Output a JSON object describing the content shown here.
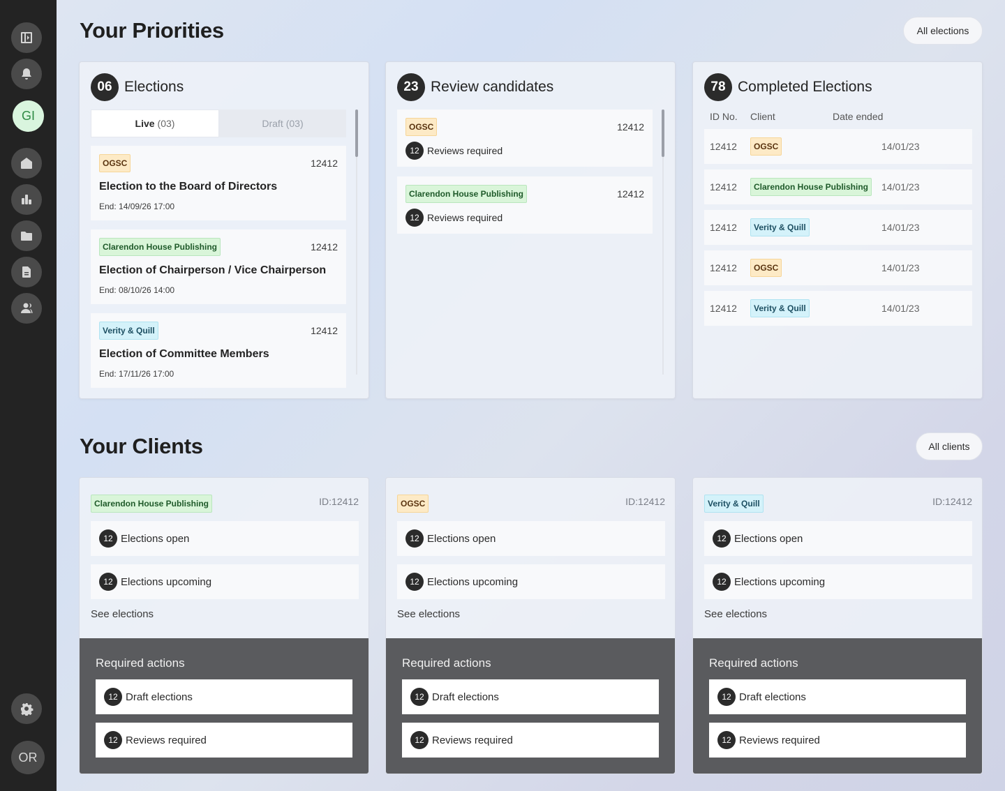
{
  "sidebar": {
    "user_initials": "GI",
    "profile_initials": "OR"
  },
  "priorities": {
    "title": "Your Priorities",
    "all_button": "All elections",
    "elections": {
      "count": "06",
      "title": "Elections",
      "tabs": [
        {
          "label": "Live",
          "count": "(03)"
        },
        {
          "label": "Draft",
          "count": "(03)"
        }
      ],
      "items": [
        {
          "tag": "OGSC",
          "id": "12412",
          "title": "Election to the Board of Directors",
          "end": "End: 14/09/26 17:00"
        },
        {
          "tag": "Clarendon House Publishing",
          "id": "12412",
          "title": "Election of Chairperson / Vice Chairperson",
          "end": "End: 08/10/26 14:00"
        },
        {
          "tag": "Verity & Quill",
          "id": "12412",
          "title": "Election of Committee Members",
          "end": "End: 17/11/26 17:00"
        }
      ]
    },
    "review": {
      "count": "23",
      "title": "Review candidates",
      "items": [
        {
          "tag": "OGSC",
          "id": "12412",
          "num": "12",
          "label": "Reviews required"
        },
        {
          "tag": "Clarendon House Publishing",
          "id": "12412",
          "num": "12",
          "label": "Reviews required"
        }
      ]
    },
    "completed": {
      "count": "78",
      "title": "Completed Elections",
      "headers": {
        "id": "ID No.",
        "client": "Client",
        "date": "Date ended"
      },
      "rows": [
        {
          "id": "12412",
          "client": "OGSC",
          "date": "14/01/23"
        },
        {
          "id": "12412",
          "client": "Clarendon House Publishing",
          "date": "14/01/23"
        },
        {
          "id": "12412",
          "client": "Verity & Quill",
          "date": "14/01/23"
        },
        {
          "id": "12412",
          "client": "OGSC",
          "date": "14/01/23"
        },
        {
          "id": "12412",
          "client": "Verity & Quill",
          "date": "14/01/23"
        }
      ]
    }
  },
  "clients": {
    "title": "Your Clients",
    "all_button": "All clients",
    "cards": [
      {
        "tag": "Clarendon House Publishing",
        "id_label": "ID:12412",
        "rows": [
          {
            "num": "12",
            "label": "Elections open"
          },
          {
            "num": "12",
            "label": "Elections upcoming"
          }
        ],
        "see": "See elections",
        "required_title": "Required actions",
        "required": [
          {
            "num": "12",
            "label": "Draft elections"
          },
          {
            "num": "12",
            "label": "Reviews required"
          }
        ]
      },
      {
        "tag": "OGSC",
        "id_label": "ID:12412",
        "rows": [
          {
            "num": "12",
            "label": "Elections open"
          },
          {
            "num": "12",
            "label": "Elections upcoming"
          }
        ],
        "see": "See elections",
        "required_title": "Required actions",
        "required": [
          {
            "num": "12",
            "label": "Draft elections"
          },
          {
            "num": "12",
            "label": "Reviews required"
          }
        ]
      },
      {
        "tag": "Verity & Quill",
        "id_label": "ID:12412",
        "rows": [
          {
            "num": "12",
            "label": "Elections open"
          },
          {
            "num": "12",
            "label": "Elections upcoming"
          }
        ],
        "see": "See elections",
        "required_title": "Required actions",
        "required": [
          {
            "num": "12",
            "label": "Draft elections"
          },
          {
            "num": "12",
            "label": "Reviews required"
          }
        ]
      }
    ]
  }
}
